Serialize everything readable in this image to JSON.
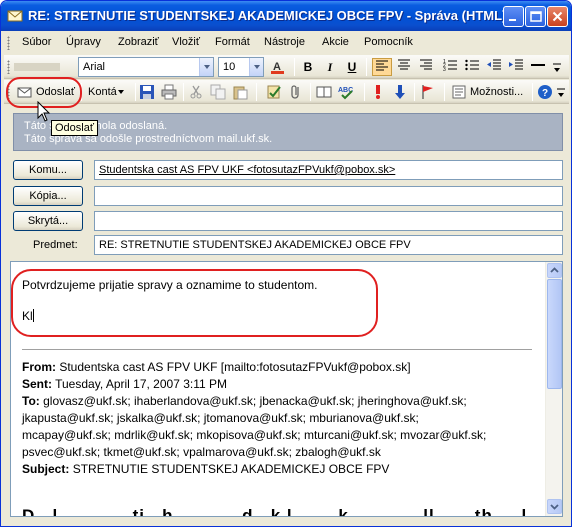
{
  "window": {
    "title": "RE: STRETNUTIE STUDENTSKEJ AKADEMICKEJ OBCE FPV - Správa (HTML)"
  },
  "menu": [
    "Súbor",
    "Úpravy",
    "Zobraziť",
    "Vložiť",
    "Formát",
    "Nástroje",
    "Akcie",
    "Pomocník"
  ],
  "format_toolbar": {
    "font": "Arial",
    "size": "10",
    "bold": "B",
    "italic": "I",
    "underline": "U"
  },
  "send_toolbar": {
    "send_label": "Odoslať",
    "accounts_label": "Kontá",
    "options_label": "Možnosti..."
  },
  "tooltip": "Odoslať",
  "infobar": {
    "line1_start": "Táto s",
    "line1_end": "nola odoslaná.",
    "line2": "Táto správa sa odošle prostredníctvom mail.ukf.sk."
  },
  "header": {
    "to_button": "Komu...",
    "to_value": "Studentska cast AS FPV UKF <fotosutazFPVukf@pobox.sk>",
    "cc_button": "Kópia...",
    "cc_value": "",
    "bcc_button": "Skrytá...",
    "bcc_value": "",
    "subject_label": "Predmet:",
    "subject_value": "RE: STRETNUTIE STUDENTSKEJ AKADEMICKEJ OBCE FPV"
  },
  "body": {
    "reply_line": "Potvrdzujeme prijatie spravy a oznamime to studentom.",
    "typing": "Kl",
    "quoted": {
      "from_label": "From:",
      "from_value": "Studentska cast AS FPV UKF [mailto:fotosutazFPVukf@pobox.sk]",
      "sent_label": "Sent:",
      "sent_value": "Tuesday, April 17, 2007 3:11 PM",
      "to_label": "To:",
      "to_line1": "glovasz@ukf.sk; ihaberlandova@ukf.sk; jbenacka@ukf.sk; jheringhova@ukf.sk;",
      "to_line2": "jkapusta@ukf.sk; jskalka@ukf.sk; jtomanova@ukf.sk; mburianova@ukf.sk;",
      "to_line3": "mcapay@ukf.sk; mdrlik@ukf.sk; mkopisova@ukf.sk; mturcani@ukf.sk; mvozar@ukf.sk;",
      "to_line4": "psvec@ukf.sk; tkmet@ukf.sk; vpalmarova@ukf.sk; zbalogh@ukf.sk",
      "subject_label": "Subject:",
      "subject_value": "STRETNUTIE STUDENTSKEJ AKADEMICKEJ OBCE FPV",
      "bottom_partial": "D   l             ti   h            d   k l        k             ll       th     l"
    }
  }
}
